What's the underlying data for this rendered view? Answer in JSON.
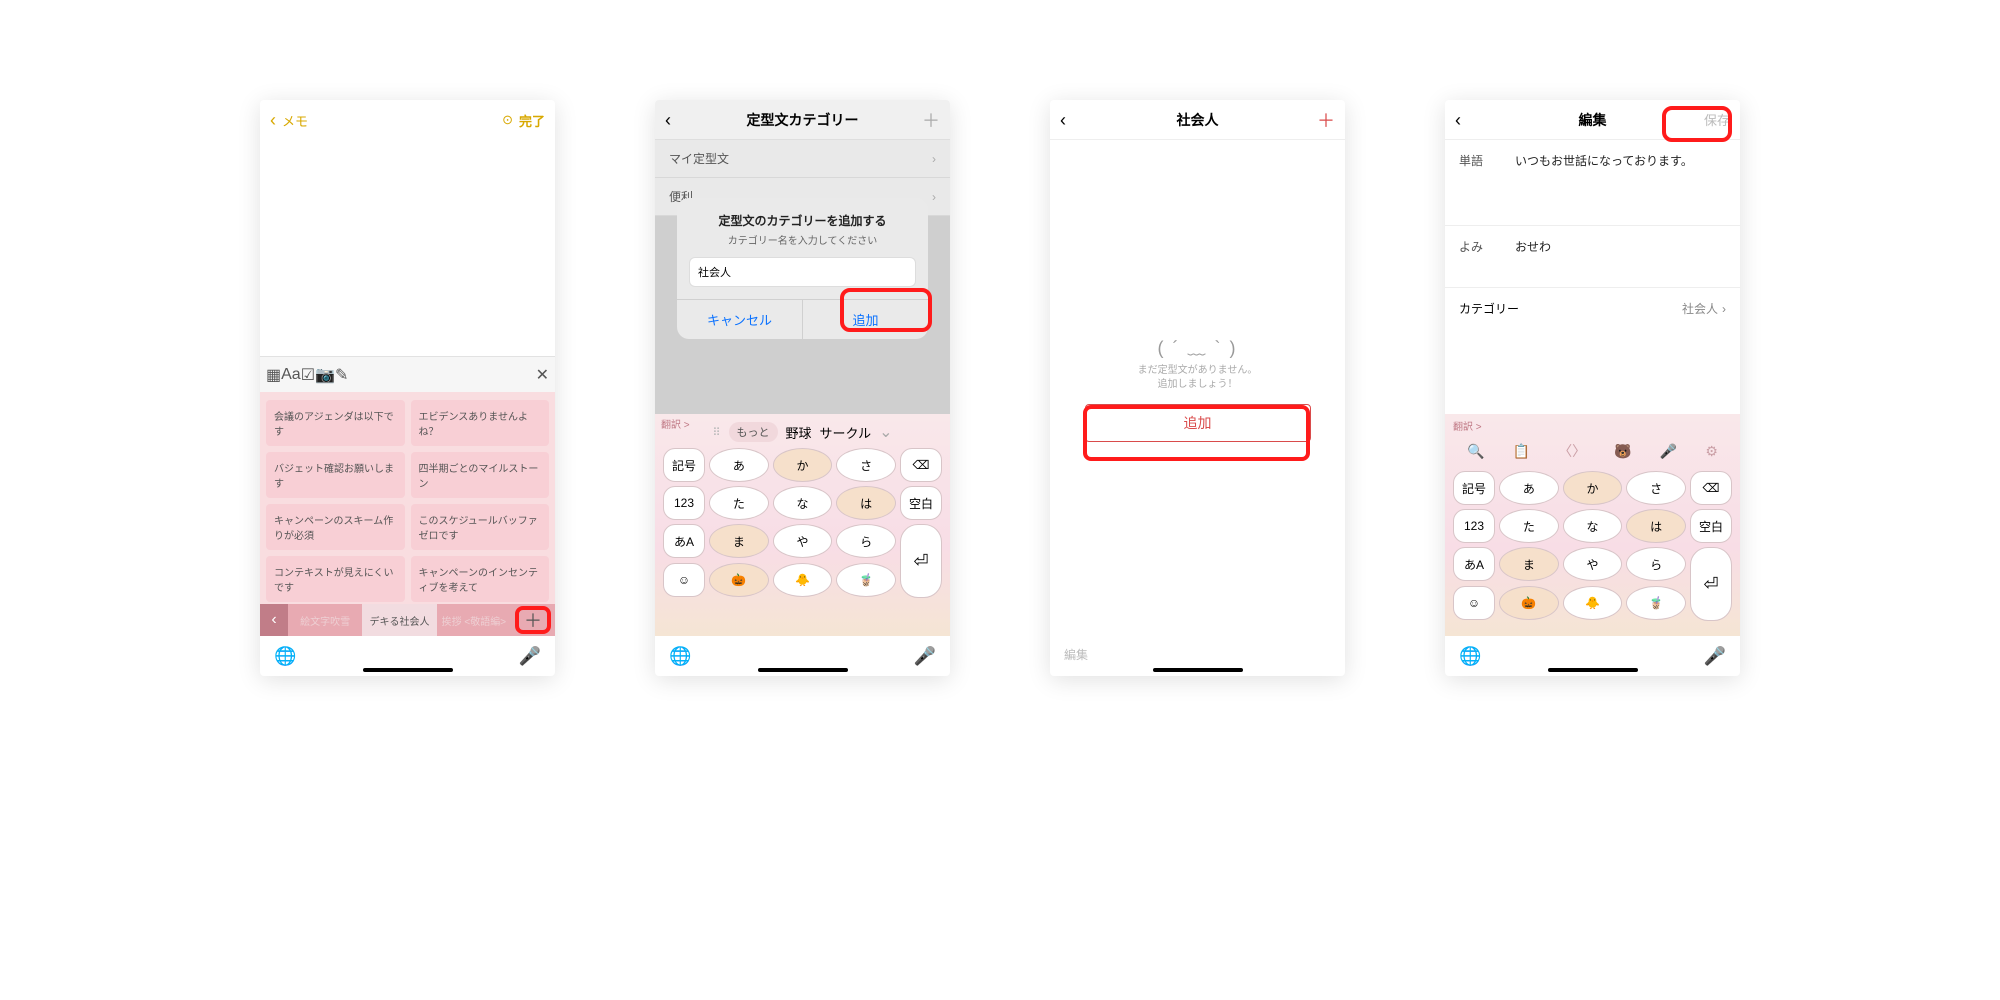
{
  "phone1": {
    "nav": {
      "back": "メモ",
      "done": "完了"
    },
    "suggestions": [
      "会議のアジェンダは以下です",
      "エビデンスありませんよね？",
      "バジェット確認お願いします",
      "四半期ごとのマイルストーン",
      "キャンペーンのスキーム作りが必須",
      "このスケジュールバッファゼロです",
      "コンテキストが見えにくいです",
      "キャンペーンのインセンティブを考えて"
    ],
    "tabs": {
      "t1": "絵文字吹雪",
      "t2": "デキる社会人",
      "t3": "挨拶\n<敬語編>"
    }
  },
  "phone2": {
    "title": "定型文カテゴリー",
    "rows": {
      "r1": "マイ定型文",
      "r2": "便利"
    },
    "modal": {
      "title": "定型文のカテゴリーを追加する",
      "sub": "カテゴリー名を入力してください",
      "value": "社会人",
      "cancel": "キャンセル",
      "ok": "追加"
    },
    "candidates": {
      "more": "もっと",
      "c1": "野球",
      "c2": "サークル"
    },
    "keys": {
      "kigo": "記号",
      "a": "あ",
      "ka": "か",
      "sa": "さ",
      "n123": "123",
      "ta": "た",
      "na": "な",
      "ha": "は",
      "kuhaku": "空白",
      "aA": "あA",
      "ma": "ま",
      "ya": "や",
      "ra": "ら"
    },
    "translate": "翻訳 >"
  },
  "phone3": {
    "title": "社会人",
    "face": "( ´  ﹏  ` )",
    "msg1": "まだ定型文がありません。",
    "msg2": "追加しましょう！",
    "add": "追加",
    "footer": "編集"
  },
  "phone4": {
    "title": "編集",
    "save": "保存",
    "row1": {
      "label": "単語",
      "value": "いつもお世話になっております。"
    },
    "row2": {
      "label": "よみ",
      "value": "おせわ"
    },
    "catrow": {
      "label": "カテゴリー",
      "value": "社会人"
    },
    "translate": "翻訳 >",
    "keys": {
      "kigo": "記号",
      "a": "あ",
      "ka": "か",
      "sa": "さ",
      "n123": "123",
      "ta": "た",
      "na": "な",
      "ha": "は",
      "kuhaku": "空白",
      "aA": "あA",
      "ma": "ま",
      "ya": "や",
      "ra": "ら"
    }
  }
}
